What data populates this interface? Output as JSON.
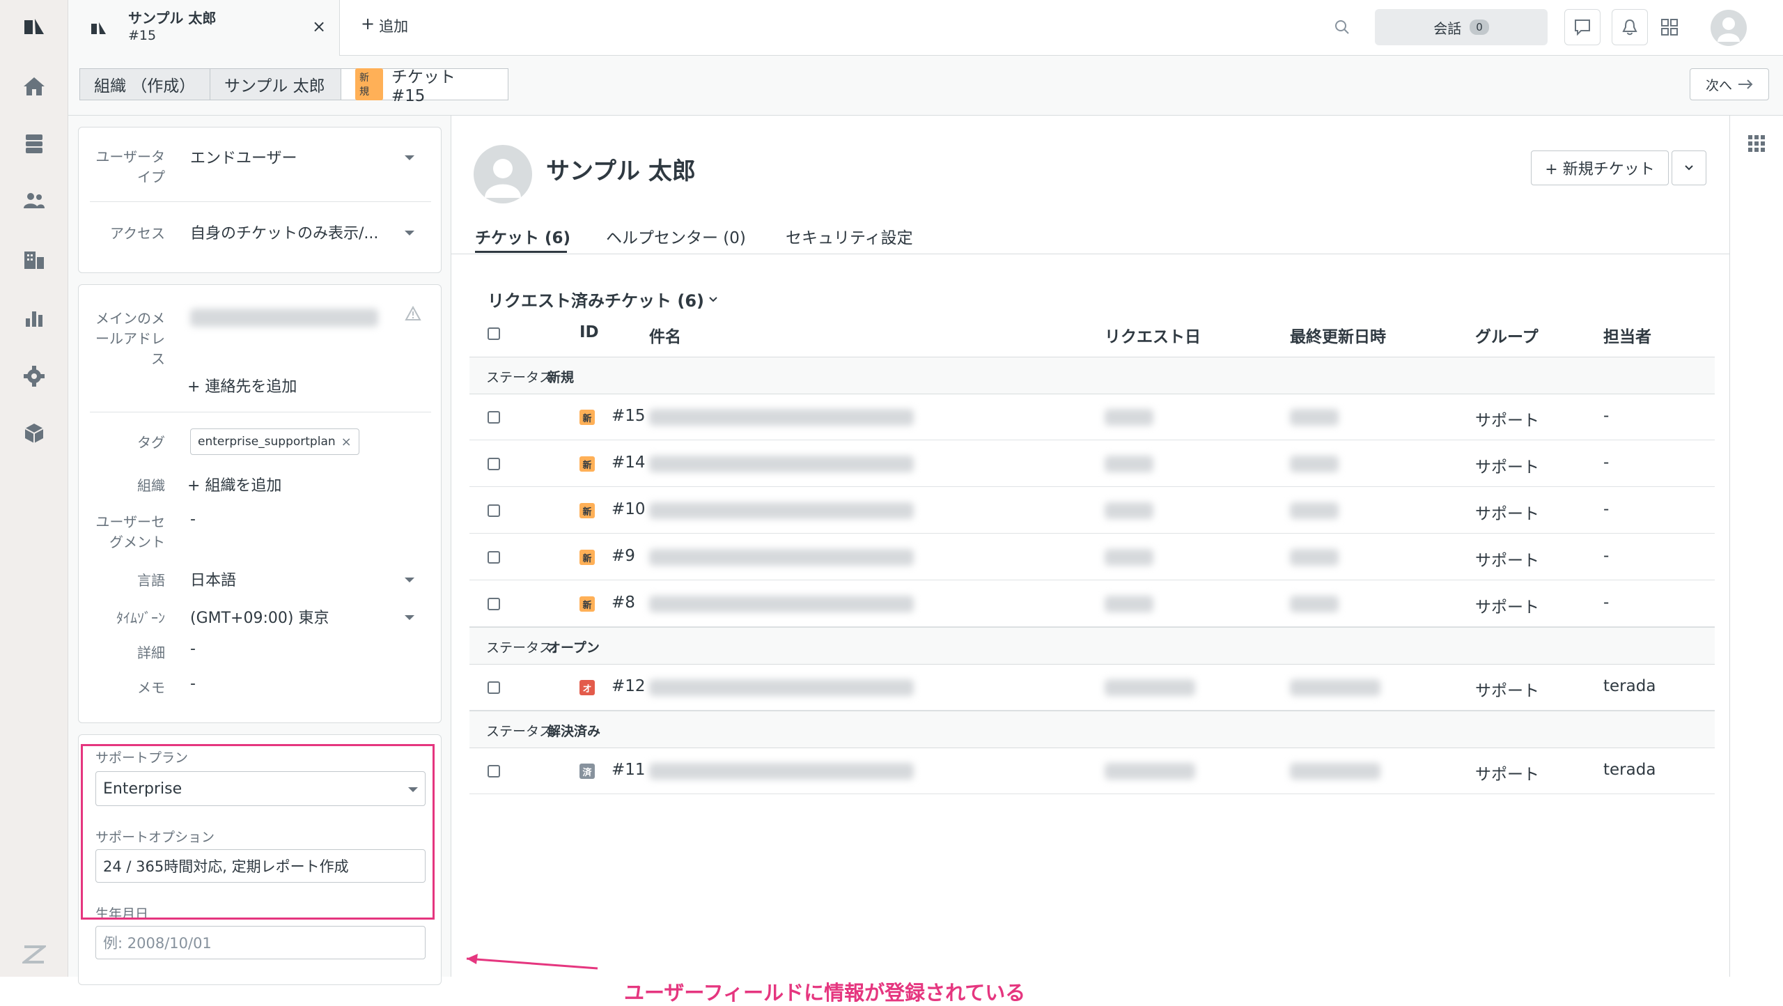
{
  "colors": {
    "accent_pink": "#e5367f",
    "new_badge": "#ffb057",
    "open_badge": "#e35b4b",
    "solved_badge": "#87929d",
    "rail_bg": "#f1eeec"
  },
  "rail": {
    "icons": [
      "zendesk-logo-icon",
      "home-icon",
      "views-icon",
      "customers-icon",
      "organizations-icon",
      "reporting-icon",
      "admin-gear-icon",
      "apps-box-icon",
      "zendesk-footer-icon"
    ]
  },
  "topbar": {
    "tab": {
      "title": "サンプル 太郎",
      "subtitle": "#15",
      "close": "×"
    },
    "add_label": "追加",
    "add_plus": "+",
    "conversation_label": "会話",
    "conversation_count": "0"
  },
  "breadcrumb": {
    "org": "組織 （作成）",
    "user": "サンプル 太郎",
    "ticket_badge": "新規",
    "ticket": "チケット #15",
    "next": "次へ"
  },
  "user_panel": {
    "user_type_label": "ユーザータイプ",
    "user_type_value": "エンドユーザー",
    "access_label": "アクセス",
    "access_value": "自身のチケットのみ表示/...",
    "email_label": "メインのメールアドレス",
    "add_contact": "+ 連絡先を追加",
    "tag_label": "タグ",
    "tag_value": "enterprise_supportplan",
    "tag_remove": "×",
    "org_label": "組織",
    "org_value": "+ 組織を追加",
    "segment_label": "ユーザーセグメント",
    "segment_value": "-",
    "language_label": "言語",
    "language_value": "日本語",
    "timezone_label": "ﾀｲﾑｿﾞｰﾝ",
    "timezone_value": "(GMT+09:00) 東京",
    "details_label": "詳細",
    "details_value": "-",
    "notes_label": "メモ",
    "notes_value": "-",
    "support_plan_label": "サポートプラン",
    "support_plan_value": "Enterprise",
    "support_option_label": "サポートオプション",
    "support_option_value": "24 / 365時間対応, 定期レポート作成",
    "birthday_label": "生年月日",
    "birthday_placeholder": "例: 2008/10/01"
  },
  "profile": {
    "name": "サンプル 太郎",
    "new_ticket": "+ 新規チケット",
    "tabs": [
      "チケット (6)",
      "ヘルプセンター (0)",
      "セキュリティ設定"
    ]
  },
  "tickets": {
    "section_title": "リクエスト済みチケット (6)",
    "columns": [
      "ID",
      "件名",
      "リクエスト日",
      "最終更新日時",
      "グループ",
      "担当者"
    ],
    "status_prefix": "ステータス: ",
    "groups": [
      {
        "status": "新規",
        "rows": [
          {
            "badge": "新",
            "id": "#15",
            "group": "サポート",
            "assignee": "-"
          },
          {
            "badge": "新",
            "id": "#14",
            "group": "サポート",
            "assignee": "-"
          },
          {
            "badge": "新",
            "id": "#10",
            "group": "サポート",
            "assignee": "-"
          },
          {
            "badge": "新",
            "id": "#9",
            "group": "サポート",
            "assignee": "-"
          },
          {
            "badge": "新",
            "id": "#8",
            "group": "サポート",
            "assignee": "-"
          }
        ]
      },
      {
        "status": "オープン",
        "rows": [
          {
            "badge": "オ",
            "id": "#12",
            "group": "サポート",
            "assignee": "terada"
          }
        ]
      },
      {
        "status": "解決済み",
        "rows": [
          {
            "badge": "済",
            "id": "#11",
            "group": "サポート",
            "assignee": "terada"
          }
        ]
      }
    ]
  },
  "annotation": {
    "text": "ユーザーフィールドに情報が登録されている"
  }
}
